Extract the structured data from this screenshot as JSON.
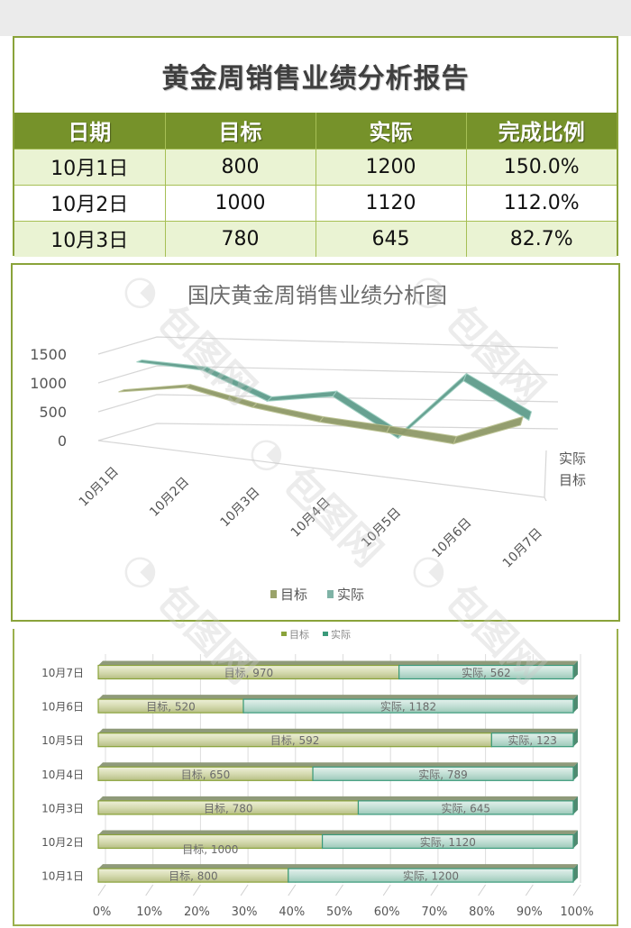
{
  "report": {
    "title": "黄金周销售业绩分析报告",
    "columns": [
      "日期",
      "目标",
      "实际",
      "完成比例"
    ],
    "rows": [
      {
        "date": "10月1日",
        "target": "800",
        "actual": "1200",
        "ratio": "150.0%"
      },
      {
        "date": "10月2日",
        "target": "1000",
        "actual": "1120",
        "ratio": "112.0%"
      },
      {
        "date": "10月3日",
        "target": "780",
        "actual": "645",
        "ratio": "82.7%"
      }
    ]
  },
  "colors": {
    "header_green": "#76922a",
    "border_green": "#8aa33a",
    "row_light": "#eaf3d3",
    "target_series": "#9aa36a",
    "actual_series": "#6fa79a"
  },
  "chart_data": [
    {
      "type": "line",
      "title": "国庆黄金周销售业绩分析图",
      "categories": [
        "10月1日",
        "10月2日",
        "10月3日",
        "10月4日",
        "10月5日",
        "10月6日",
        "10月7日"
      ],
      "series": [
        {
          "name": "目标",
          "values": [
            800,
            1000,
            780,
            650,
            592,
            520,
            970
          ]
        },
        {
          "name": "实际",
          "values": [
            1200,
            1120,
            645,
            789,
            123,
            1182,
            562
          ]
        }
      ],
      "yticks": [
        0,
        500,
        1000,
        1500
      ],
      "ylim": [
        0,
        1500
      ],
      "depth_labels": [
        "实际",
        "目标"
      ],
      "legend": [
        "目标",
        "实际"
      ],
      "legend_position": "bottom",
      "grid": true
    },
    {
      "type": "bar",
      "stacked": "percent",
      "orientation": "horizontal",
      "legend": [
        "目标",
        "实际"
      ],
      "legend_position": "top",
      "categories": [
        "10月7日",
        "10月6日",
        "10月5日",
        "10月4日",
        "10月3日",
        "10月2日",
        "10月1日"
      ],
      "series": [
        {
          "name": "目标",
          "values": [
            970,
            520,
            592,
            650,
            780,
            1000,
            800
          ]
        },
        {
          "name": "实际",
          "values": [
            562,
            1182,
            123,
            789,
            645,
            1120,
            1200
          ]
        }
      ],
      "xticks": [
        "0%",
        "10%",
        "20%",
        "30%",
        "40%",
        "50%",
        "60%",
        "70%",
        "80%",
        "90%",
        "100%"
      ],
      "xlim": [
        0,
        1
      ],
      "grid": true
    }
  ]
}
